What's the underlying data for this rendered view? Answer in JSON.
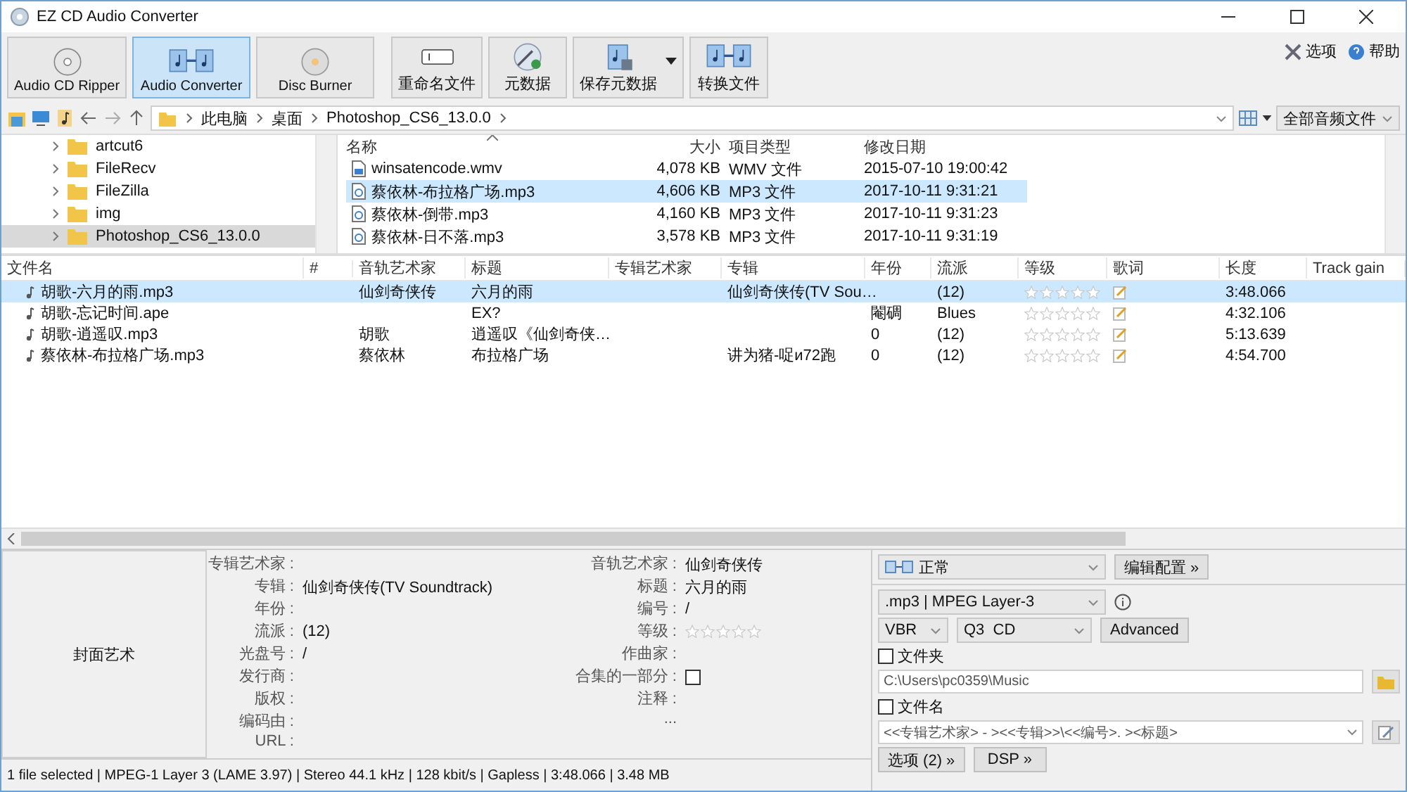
{
  "window": {
    "title": "EZ CD Audio Converter"
  },
  "modes": [
    {
      "label": "Audio CD Ripper",
      "kind": "cd",
      "selected": false
    },
    {
      "label": "Audio Converter",
      "kind": "convert",
      "selected": true
    },
    {
      "label": "Disc Burner",
      "kind": "disc",
      "selected": false
    }
  ],
  "toolbar": [
    {
      "label": "重命名文件",
      "kind": "rename"
    },
    {
      "label": "元数据",
      "kind": "metadata"
    },
    {
      "label": "保存元数据",
      "kind": "save"
    },
    {
      "label": "转换文件",
      "kind": "convert"
    }
  ],
  "top_links": [
    {
      "label": "选项",
      "kind": "options"
    },
    {
      "label": "帮助",
      "kind": "help"
    }
  ],
  "address": {
    "path": [
      "此电脑",
      "桌面",
      "Photoshop_CS6_13.0.0"
    ],
    "filter": "全部音频文件"
  },
  "folders": [
    {
      "name": "artcut6",
      "selected": false
    },
    {
      "name": "FileRecv",
      "selected": false
    },
    {
      "name": "FileZilla",
      "selected": false
    },
    {
      "name": "img",
      "selected": false
    },
    {
      "name": "Photoshop_CS6_13.0.0",
      "selected": true
    }
  ],
  "files": {
    "columns": [
      "名称",
      "大小",
      "项目类型",
      "修改日期"
    ],
    "rows": [
      {
        "kind": "video",
        "name": "winsatencode.wmv",
        "size": "4,078 KB",
        "type": "WMV 文件",
        "modified": "2015-07-10 19:00:42",
        "selected": false
      },
      {
        "kind": "audio",
        "name": "蔡依林-布拉格广场.mp3",
        "size": "4,606 KB",
        "type": "MP3 文件",
        "modified": "2017-10-11 9:31:21",
        "selected": true
      },
      {
        "kind": "audio",
        "name": "蔡依林-倒带.mp3",
        "size": "4,160 KB",
        "type": "MP3 文件",
        "modified": "2017-10-11 9:31:23",
        "selected": false
      },
      {
        "kind": "audio",
        "name": "蔡依林-日不落.mp3",
        "size": "3,578 KB",
        "type": "MP3 文件",
        "modified": "2017-10-11 9:31:19",
        "selected": false
      }
    ]
  },
  "tracks": {
    "columns": [
      "文件名",
      "#",
      "音轨艺术家",
      "标题",
      "专辑艺术家",
      "专辑",
      "年份",
      "流派",
      "等级",
      "歌词",
      "长度",
      "Track gain"
    ],
    "rows": [
      {
        "file": "胡歌-六月的雨.mp3",
        "track_artist": "仙剑奇侠传",
        "title": "六月的雨",
        "album": "仙剑奇侠传(TV Sou…",
        "genre": "(12)",
        "stars": 0,
        "length": "3:48.066",
        "selected": true
      },
      {
        "file": "胡歌-忘记时间.ape",
        "title": "EX?",
        "year": "閹碉",
        "genre": "Blues",
        "stars": 0,
        "length": "4:32.106",
        "selected": false
      },
      {
        "file": "胡歌-逍遥叹.mp3",
        "track_artist": "胡歌",
        "title": "逍遥叹《仙剑奇侠…",
        "year": "0",
        "genre": "(12)",
        "stars": 0,
        "length": "5:13.639",
        "selected": false
      },
      {
        "file": "蔡依林-布拉格广场.mp3",
        "track_artist": "蔡依林",
        "title": "布拉格广场",
        "album": "讲为猪-哫и72跑",
        "year": "0",
        "genre": "(12)",
        "stars": 0,
        "length": "4:54.700",
        "selected": false
      }
    ]
  },
  "cover_art": {
    "label": "封面艺术"
  },
  "metadata": {
    "left": [
      {
        "label": "专辑艺术家 :"
      },
      {
        "label": "专辑 :",
        "value": "仙剑奇侠传(TV Soundtrack)"
      },
      {
        "label": "年份 :"
      },
      {
        "label": "流派 :",
        "value": "(12)"
      },
      {
        "label": "光盘号 :",
        "value": "/"
      },
      {
        "label": "发行商 :"
      },
      {
        "label": "版权 :"
      },
      {
        "label": "编码由 :"
      },
      {
        "label": "URL :"
      }
    ],
    "right": [
      {
        "label": "音轨艺术家 :",
        "value": "仙剑奇侠传",
        "kind": "text"
      },
      {
        "label": "标题 :",
        "value": "六月的雨",
        "kind": "text"
      },
      {
        "label": "编号 :",
        "value": "/",
        "kind": "text"
      },
      {
        "label": "等级 :",
        "kind": "stars",
        "stars": 0
      },
      {
        "label": "作曲家 :",
        "kind": "text"
      },
      {
        "label": "合集的一部分 :",
        "kind": "checkbox",
        "checked": false
      },
      {
        "label": "注释 :",
        "kind": "text"
      },
      {
        "label": "...",
        "kind": "more"
      }
    ]
  },
  "output": {
    "profile": "正常",
    "edit_profile": "编辑配置 »",
    "format": ".mp3 | MPEG Layer-3",
    "mode": "VBR",
    "quality": "Q3  CD",
    "advanced": "Advanced",
    "folder": {
      "label": "文件夹",
      "checked": false,
      "value": "C:\\Users\\pc0359\\Music"
    },
    "filename": {
      "label": "文件名",
      "checked": false,
      "value": "<<专辑艺术家> - ><<专辑>>\\<<编号>. ><标题>"
    },
    "buttons": [
      "选项 (2) »",
      "DSP »"
    ]
  },
  "status_bar": "1 file selected | MPEG-1 Layer 3 (LAME 3.97) | Stereo 44.1 kHz | 128 kbit/s | Gapless | 3:48.066 | 3.48 MB"
}
